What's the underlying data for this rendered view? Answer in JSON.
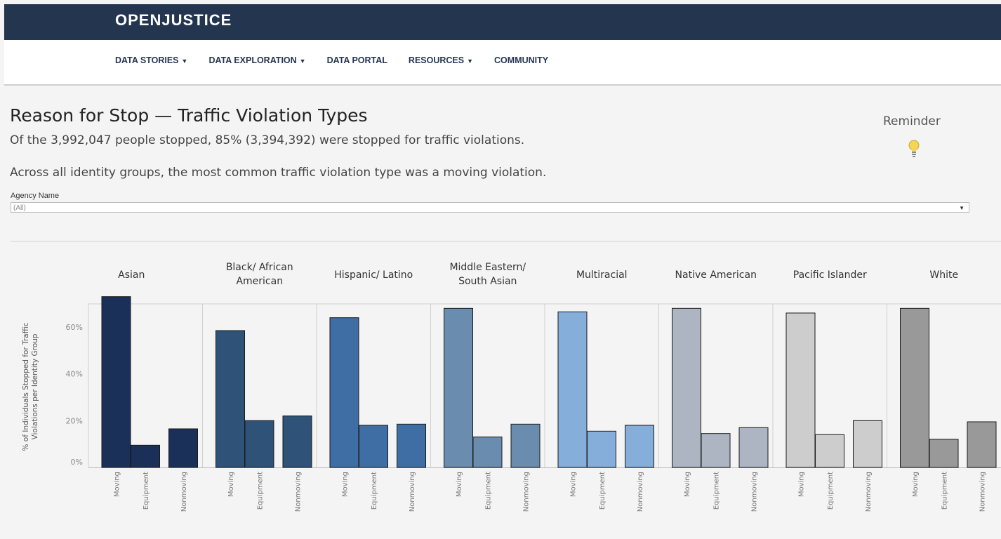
{
  "header": {
    "logo_text": "OPENJUSTICE"
  },
  "nav": [
    {
      "label": "DATA STORIES",
      "dropdown": true
    },
    {
      "label": "DATA EXPLORATION",
      "dropdown": true
    },
    {
      "label": "DATA PORTAL",
      "dropdown": false
    },
    {
      "label": "RESOURCES",
      "dropdown": true
    },
    {
      "label": "COMMUNITY",
      "dropdown": false
    }
  ],
  "page": {
    "title": "Reason for Stop — Traffic Violation Types",
    "subtitle": "Of the 3,992,047 people stopped, 85% (3,394,392) were stopped for traffic violations.",
    "subtitle2": "Across all identity groups, the most common traffic violation type was a moving violation.",
    "reminder_label": "Reminder"
  },
  "filter": {
    "label": "Agency Name",
    "value": "(All)"
  },
  "colors": {
    "header_bg": "#243550"
  },
  "chart_data": {
    "type": "bar",
    "ylabel": "% of Individuals Stopped for Traffic Violations per Identity Group",
    "ylim": [
      0,
      0.75
    ],
    "yticks": [
      0,
      0.2,
      0.4,
      0.6
    ],
    "ytick_labels": [
      "0%",
      "20%",
      "40%",
      "60%"
    ],
    "categories": [
      "Moving",
      "Equipment",
      "Nonmoving"
    ],
    "groups": [
      {
        "name": "Asian",
        "label_lines": [
          "Asian"
        ],
        "color": "#1a3058",
        "values": [
          0.73,
          0.095,
          0.165
        ]
      },
      {
        "name": "Black/ African American",
        "label_lines": [
          "Black/ African",
          "American"
        ],
        "color": "#2e5278",
        "values": [
          0.585,
          0.2,
          0.22
        ]
      },
      {
        "name": "Hispanic/ Latino",
        "label_lines": [
          "Hispanic/ Latino"
        ],
        "color": "#3e6ea4",
        "values": [
          0.64,
          0.18,
          0.185
        ]
      },
      {
        "name": "Middle Eastern/ South Asian",
        "label_lines": [
          "Middle Eastern/",
          "South Asian"
        ],
        "color": "#6a8caf",
        "values": [
          0.68,
          0.13,
          0.185
        ]
      },
      {
        "name": "Multiracial",
        "label_lines": [
          "Multiracial"
        ],
        "color": "#86aedb",
        "values": [
          0.665,
          0.155,
          0.18
        ]
      },
      {
        "name": "Native American",
        "label_lines": [
          "Native American"
        ],
        "color": "#adb4c2",
        "values": [
          0.68,
          0.145,
          0.17
        ]
      },
      {
        "name": "Pacific Islander",
        "label_lines": [
          "Pacific Islander"
        ],
        "color": "#cdcdcd",
        "values": [
          0.66,
          0.14,
          0.2
        ]
      },
      {
        "name": "White",
        "label_lines": [
          "White"
        ],
        "color": "#999999",
        "values": [
          0.68,
          0.12,
          0.195
        ]
      }
    ]
  }
}
